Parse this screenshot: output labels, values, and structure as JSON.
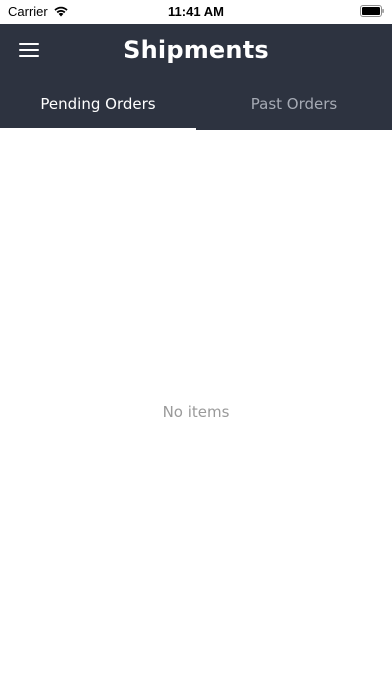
{
  "status_bar": {
    "carrier": "Carrier",
    "time": "11:41 AM",
    "wifi_icon": "wifi-icon",
    "battery_icon": "battery-icon"
  },
  "header": {
    "title": "Shipments",
    "menu_icon": "hamburger-menu-icon",
    "background_color": "#2d3340"
  },
  "tabs": [
    {
      "label": "Pending Orders",
      "active": true
    },
    {
      "label": "Past Orders",
      "active": false
    }
  ],
  "content": {
    "empty_message": "No items"
  }
}
